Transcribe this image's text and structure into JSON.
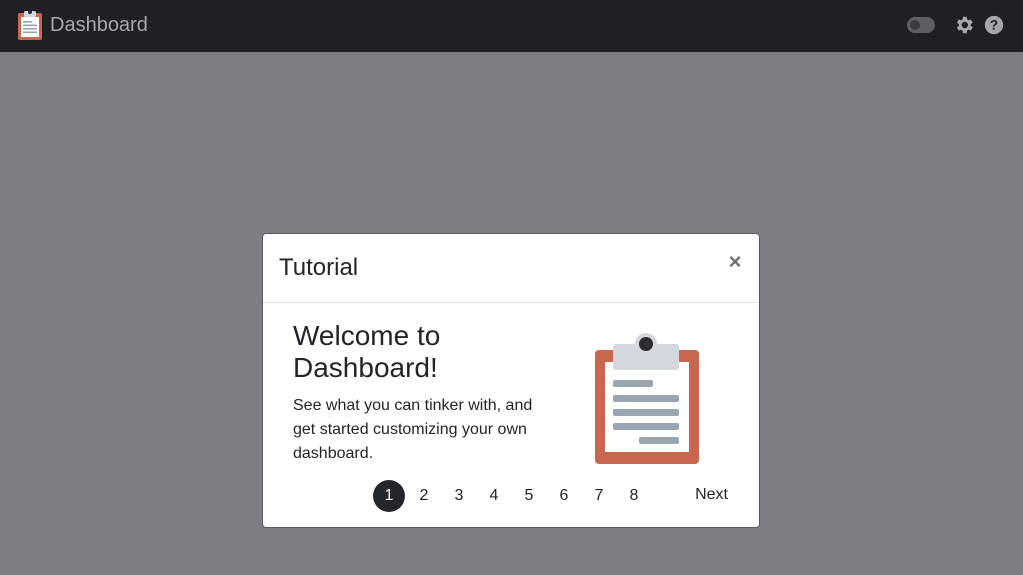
{
  "navbar": {
    "title": "Dashboard",
    "brand_icon": "clipboard-icon",
    "toggle_icon": "toggle-switch-icon",
    "settings_icon": "gear-icon",
    "help_icon": "question-circle-icon"
  },
  "modal": {
    "title": "Tutorial",
    "close_label": "×",
    "heading": "Welcome to Dashboard!",
    "body": "See what you can tinker with, and get started customizing your own dashboard.",
    "illustration": "clipboard-icon",
    "pages": [
      "1",
      "2",
      "3",
      "4",
      "5",
      "6",
      "7",
      "8"
    ],
    "active_page": 1,
    "next_label": "Next"
  },
  "colors": {
    "navbar_bg": "#1f2023",
    "backdrop": "#7d7e81",
    "clipboard_board": "#c8674e",
    "clipboard_clip": "#d3d8de",
    "clipboard_lines": "#99a6b2",
    "active_page_bg": "#23272b"
  }
}
